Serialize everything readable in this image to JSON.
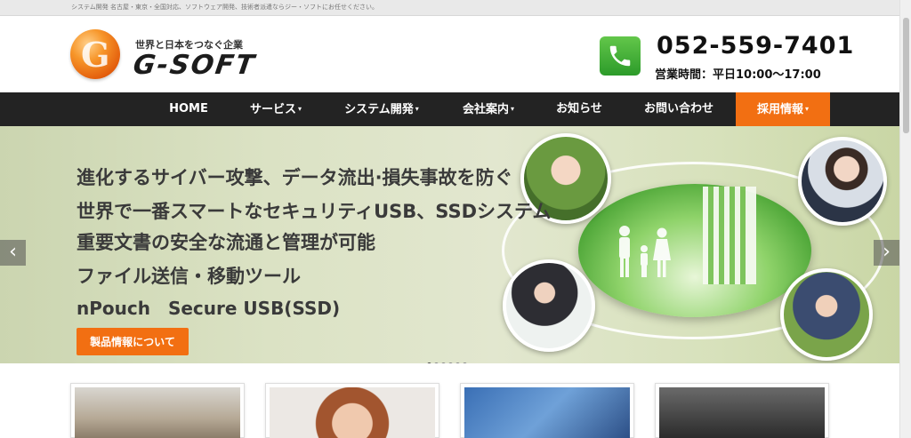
{
  "topbar": {
    "text": "システム開発 名古屋・東京・全国対応、ソフトウェア開発、技術者派遣ならジー・ソフトにお任せください。"
  },
  "header": {
    "logo_letter": "G",
    "tagline": "世界と日本をつなぐ企業",
    "brand": "G-SOFT",
    "phone": "052-559-7401",
    "hours": "営業時間：平日10:00〜17:00"
  },
  "nav": {
    "items": [
      {
        "label": "HOME",
        "caret": ""
      },
      {
        "label": "サービス",
        "caret": "▾"
      },
      {
        "label": "システム開発",
        "caret": "▾"
      },
      {
        "label": "会社案内",
        "caret": "▾"
      },
      {
        "label": "お知らせ",
        "caret": ""
      },
      {
        "label": "お問い合わせ",
        "caret": ""
      },
      {
        "label": "採用情報",
        "caret": "▾"
      }
    ]
  },
  "hero": {
    "line1": "進化するサイバー攻撃、データ流出·損失事故を防ぐ",
    "line2": "世界で一番スマートなセキュリティUSB、SSDシステム",
    "line3": "重要文書の安全な流通と管理が可能",
    "line4": "ファイル送信・移動ツール",
    "line5": "nPouch　Secure USB(SSD)",
    "button": "製品情報について",
    "prev": "‹",
    "next": "›",
    "slides": 6,
    "active_slide": 1
  },
  "colors": {
    "accent": "#f26f12",
    "nav_bg": "#232323"
  }
}
